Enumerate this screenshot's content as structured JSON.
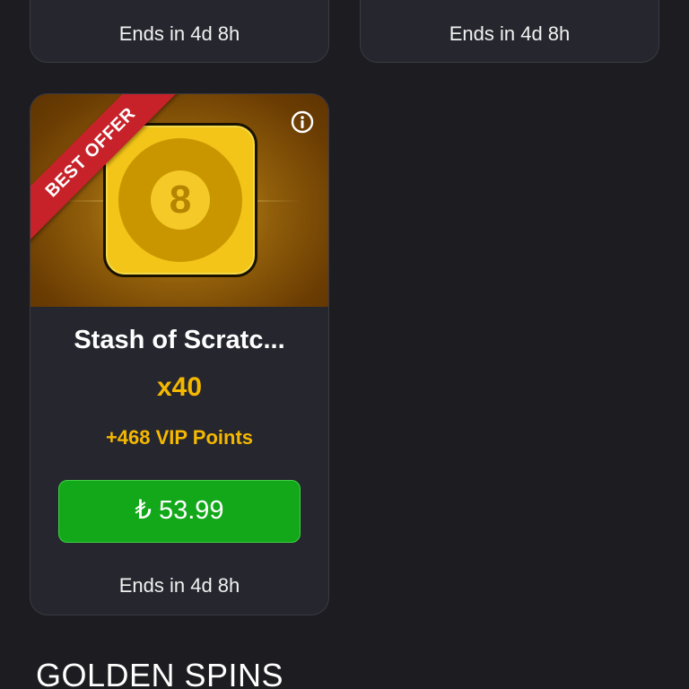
{
  "top_cards": [
    {
      "ends_text": "Ends in 4d 8h"
    },
    {
      "ends_text": "Ends in 4d 8h"
    }
  ],
  "offer_card": {
    "badge": "BEST OFFER",
    "icon": "info-icon",
    "image_icon": "eight-ball-icon",
    "ball_number": "8",
    "title": "Stash of Scratc...",
    "quantity": "x40",
    "vip_points": "+468 VIP Points",
    "price": "₺ 53.99",
    "ends_text": "Ends in 4d 8h"
  },
  "section": {
    "heading": "GOLDEN SPINS"
  },
  "colors": {
    "background": "#1c1c21",
    "card": "#26262e",
    "accent_gold": "#f5b800",
    "button_green": "#12a81a",
    "ribbon_red": "#c7222a"
  }
}
